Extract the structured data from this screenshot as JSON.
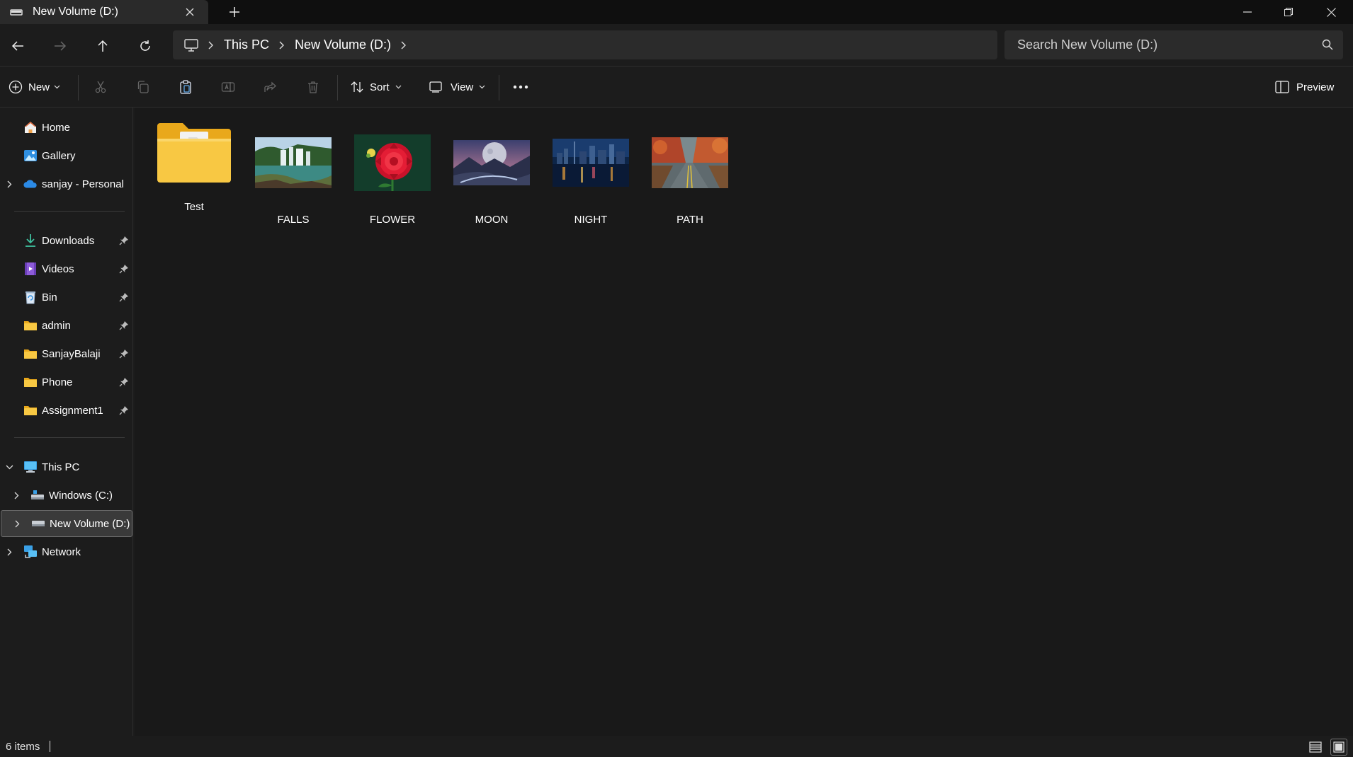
{
  "window": {
    "tab_title": "New Volume (D:)"
  },
  "address": {
    "crumbs": [
      "This PC",
      "New Volume (D:)"
    ]
  },
  "search": {
    "placeholder": "Search New Volume (D:)"
  },
  "commandbar": {
    "new_label": "New",
    "sort_label": "Sort",
    "view_label": "View",
    "preview_label": "Preview"
  },
  "sidebar": {
    "top": [
      {
        "label": "Home",
        "icon": "home-icon"
      },
      {
        "label": "Gallery",
        "icon": "gallery-icon"
      },
      {
        "label": "sanjay - Personal",
        "icon": "onedrive-cloud-icon"
      }
    ],
    "pinned": [
      {
        "label": "Downloads",
        "icon": "download-icon"
      },
      {
        "label": "Videos",
        "icon": "videos-icon"
      },
      {
        "label": "Bin",
        "icon": "recycle-bin-icon"
      },
      {
        "label": "admin",
        "icon": "folder-icon"
      },
      {
        "label": "SanjayBalaji",
        "icon": "folder-icon"
      },
      {
        "label": "Phone",
        "icon": "folder-icon"
      },
      {
        "label": "Assignment1",
        "icon": "folder-icon"
      }
    ],
    "tree": [
      {
        "label": "This PC",
        "icon": "computer-icon"
      },
      {
        "label": "Windows (C:)",
        "icon": "drive-icon"
      },
      {
        "label": "New Volume (D:)",
        "icon": "drive-icon"
      },
      {
        "label": "Network",
        "icon": "network-icon"
      }
    ]
  },
  "files": [
    {
      "name": "Test",
      "type": "folder"
    },
    {
      "name": "FALLS",
      "type": "image"
    },
    {
      "name": "FLOWER",
      "type": "image"
    },
    {
      "name": "MOON",
      "type": "image"
    },
    {
      "name": "NIGHT",
      "type": "image"
    },
    {
      "name": "PATH",
      "type": "image"
    }
  ],
  "status": {
    "item_count": "6 items"
  },
  "colors": {
    "background": "#191919",
    "folder_yellow": "#f8c843",
    "accent_blue": "#4aa3df"
  }
}
